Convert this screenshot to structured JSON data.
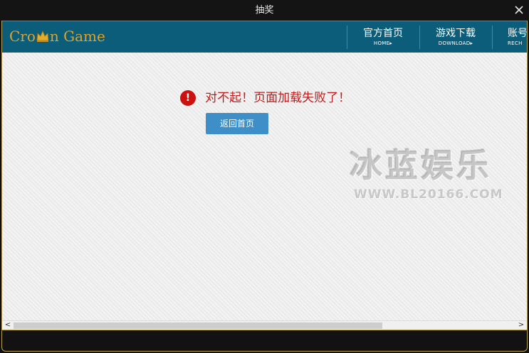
{
  "window": {
    "title": "抽奖",
    "close_icon": "close-icon"
  },
  "navbar": {
    "logo": {
      "text_before": "Cro",
      "text_after": "n Game",
      "icon": "crown-icon"
    },
    "items": [
      {
        "label": "官方首页",
        "sub": "HOME▸"
      },
      {
        "label": "游戏下载",
        "sub": "DOWNLOAD▸"
      },
      {
        "label": "账号",
        "sub": "RECH"
      }
    ]
  },
  "error": {
    "icon": "exclamation-icon",
    "message": "对不起！页面加载失败了！"
  },
  "home_button": {
    "label": "返回首页"
  },
  "watermark": {
    "main": "冰蓝娱乐",
    "url": "WWW.BL20166.COM"
  },
  "scrollbar": {
    "left_arrow": "<",
    "right_arrow": ">"
  },
  "colors": {
    "nav_bg": "#0b5d79",
    "error_red": "#cc1111",
    "button_blue": "#3e8fc8",
    "logo_gold": "#d9a431"
  }
}
